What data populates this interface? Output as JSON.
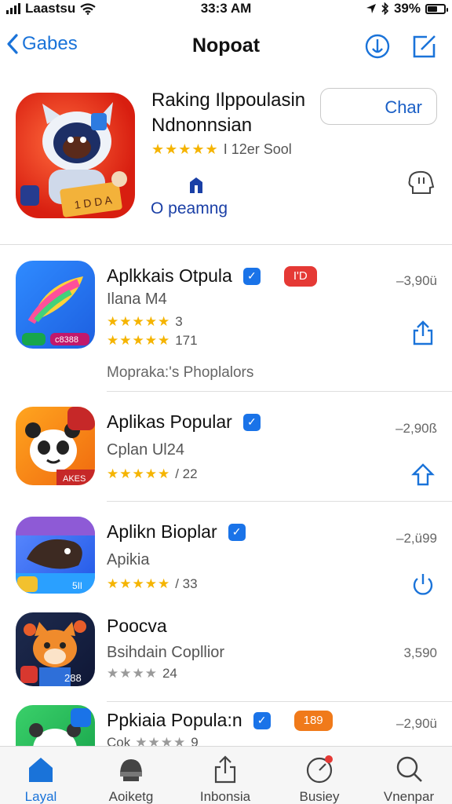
{
  "status_bar": {
    "carrier": "Laastsu",
    "time": "33:3 AM",
    "battery": "39%",
    "battery_level": 0.6
  },
  "nav": {
    "back_label": "Gabes",
    "title": "Nopoat"
  },
  "featured": {
    "title": "Raking Ilppoulasin Ndnonnsian",
    "rating_text": "I 12er Sool",
    "button_label": "Char",
    "link_label": "O peamng"
  },
  "apps": [
    {
      "name": "Aplkkais Otpula",
      "sub": "Ilana M4",
      "badge": "I'D",
      "badge_color": "#e53935",
      "ratings": [
        "3",
        "171"
      ],
      "count": "–3,90ü",
      "icon_caption": "c8388"
    },
    {
      "name": "Aplikas Popular",
      "sub": "Cplan Ul24",
      "ratings": [
        "/ 22"
      ],
      "count": "–2,90ß",
      "icon_caption": "AKES"
    },
    {
      "name": "Aplikn Bioplar",
      "sub": "Apikia",
      "ratings": [
        "/ 33"
      ],
      "count": "–2,ü99",
      "icon_caption": "5Il"
    },
    {
      "name": "Poocva",
      "sub": "Bsihdain Copllior",
      "ratings": [
        "24"
      ],
      "count": "3,590",
      "icon_caption": "288"
    },
    {
      "name": "Ppkiaia Popula:n",
      "sub": "Cok",
      "badge": "189",
      "badge_color": "#f07a1a",
      "ratings": [
        "9"
      ],
      "count": "–2,90ü"
    }
  ],
  "list_caption": "Mopraka:'s Phoplalors",
  "tabs": [
    {
      "label": "Layal",
      "icon": "home-icon",
      "active": true
    },
    {
      "label": "Aoiketg",
      "icon": "helmet-icon"
    },
    {
      "label": "Inbonsia",
      "icon": "share-icon"
    },
    {
      "label": "Busiey",
      "icon": "gauge-icon"
    },
    {
      "label": "Vnenpar",
      "icon": "search-icon"
    }
  ],
  "colors": {
    "accent": "#1a73d9",
    "star": "#f5b400",
    "featured_icon_bg": "#d81e10"
  }
}
